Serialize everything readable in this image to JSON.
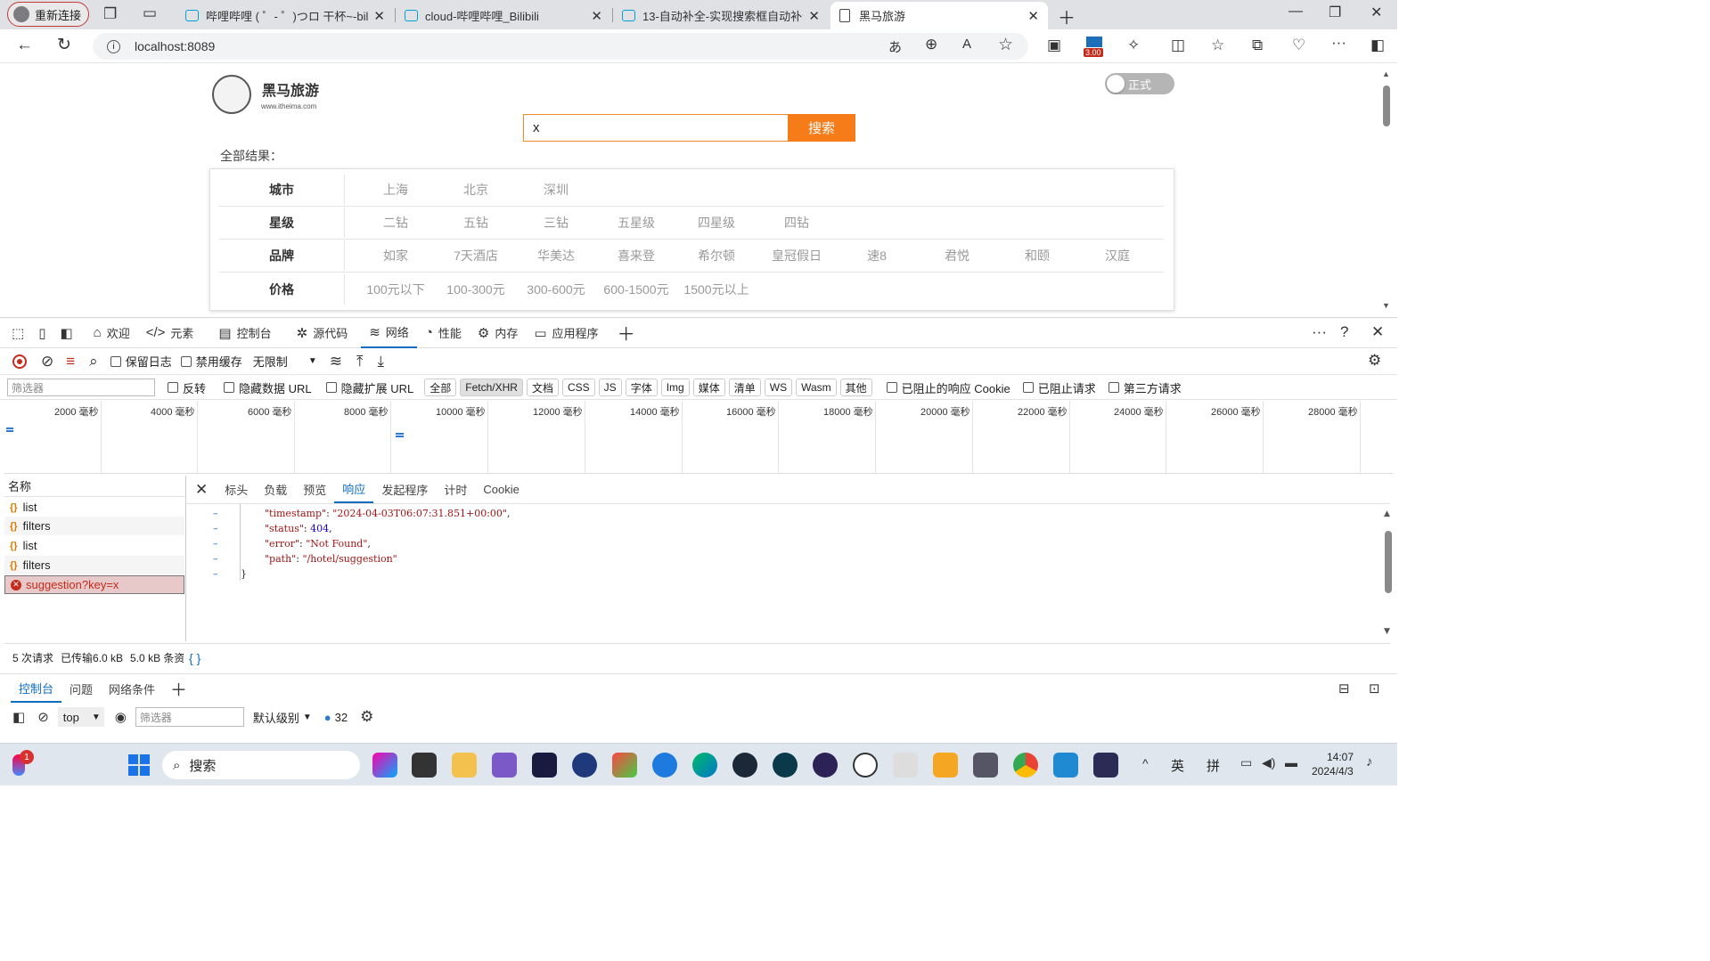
{
  "browser": {
    "profile_label": "重新连接",
    "tabs": [
      {
        "title": "哔哩哔哩 ( ゜- ゜)つロ 干杯~-bilib"
      },
      {
        "title": "cloud-哔哩哔哩_Bilibili"
      },
      {
        "title": "13-自动补全-实现搜索框自动补全"
      },
      {
        "title": "黑马旅游"
      }
    ],
    "address": "localhost:8089",
    "badge": "3.00"
  },
  "site": {
    "brand": "黑马旅游",
    "domain": "www.itheima.com",
    "toggle_label": "正式",
    "search_value": "x",
    "search_button": "搜索",
    "results_label": "全部结果：",
    "filters": [
      {
        "key": "城市",
        "values": [
          "上海",
          "北京",
          "深圳"
        ]
      },
      {
        "key": "星级",
        "values": [
          "二钻",
          "五钻",
          "三钻",
          "五星级",
          "四星级",
          "四钻"
        ]
      },
      {
        "key": "品牌",
        "values": [
          "如家",
          "7天酒店",
          "华美达",
          "喜来登",
          "希尔顿",
          "皇冠假日",
          "速8",
          "君悦",
          "和颐",
          "汉庭"
        ]
      },
      {
        "key": "价格",
        "values": [
          "100元以下",
          "100-300元",
          "300-600元",
          "600-1500元",
          "1500元以上"
        ]
      }
    ]
  },
  "devtools": {
    "tabs": [
      {
        "label": "欢迎",
        "icon": "home-icon"
      },
      {
        "label": "元素",
        "icon": "code-icon"
      },
      {
        "label": "控制台",
        "icon": "console-icon"
      },
      {
        "label": "源代码",
        "icon": "bug-icon"
      },
      {
        "label": "网络",
        "icon": "wifi-icon"
      },
      {
        "label": "性能",
        "icon": "gauge-icon"
      },
      {
        "label": "内存",
        "icon": "chip-icon"
      },
      {
        "label": "应用程序",
        "icon": "app-icon"
      }
    ],
    "toolbar": {
      "preserve_log": "保留日志",
      "disable_cache": "禁用缓存",
      "throttle": "无限制"
    },
    "filter": {
      "placeholder": "筛选器",
      "invert": "反转",
      "hide_data_urls": "隐藏数据 URL",
      "hide_ext_urls": "隐藏扩展 URL",
      "chips": [
        "全部",
        "Fetch/XHR",
        "文档",
        "CSS",
        "JS",
        "字体",
        "Img",
        "媒体",
        "清单",
        "WS",
        "Wasm",
        "其他"
      ],
      "blocked_cookies": "已阻止的响应 Cookie",
      "blocked_requests": "已阻止请求",
      "third_party": "第三方请求"
    },
    "timeline": [
      "2000 毫秒",
      "4000 毫秒",
      "6000 毫秒",
      "8000 毫秒",
      "10000 毫秒",
      "12000 毫秒",
      "14000 毫秒",
      "16000 毫秒",
      "18000 毫秒",
      "20000 毫秒",
      "22000 毫秒",
      "24000 毫秒",
      "26000 毫秒",
      "28000 毫秒"
    ],
    "requests_header": "名称",
    "requests": [
      {
        "name": "list",
        "error": false
      },
      {
        "name": "filters",
        "error": false
      },
      {
        "name": "list",
        "error": false
      },
      {
        "name": "filters",
        "error": false
      },
      {
        "name": "suggestion?key=x",
        "error": true
      }
    ],
    "detail_tabs": [
      "标头",
      "负载",
      "预览",
      "响应",
      "发起程序",
      "计时",
      "Cookie"
    ],
    "response": {
      "timestamp_key": "\"timestamp\"",
      "timestamp_val": "\"2024-04-03T06:07:31.851+00:00\"",
      "status_key": "\"status\"",
      "status_val": "404",
      "error_key": "\"error\"",
      "error_val": "\"Not Found\"",
      "path_key": "\"path\"",
      "path_val": "\"/hotel/suggestion\"",
      "close": "}"
    },
    "status_bar": {
      "requests": "5 次请求",
      "transferred": "已传输6.0 kB",
      "resources": "5.0 kB 条资",
      "braces": "{ }"
    },
    "drawer_tabs": [
      "控制台",
      "问题",
      "网络条件"
    ],
    "console": {
      "context": "top",
      "filter_placeholder": "筛选器",
      "level": "默认级别",
      "count": "32"
    }
  },
  "taskbar": {
    "search_placeholder": "搜索",
    "ime1": "英",
    "ime2": "拼",
    "time": "14:07",
    "date": "2024/4/3",
    "notification": "1"
  }
}
